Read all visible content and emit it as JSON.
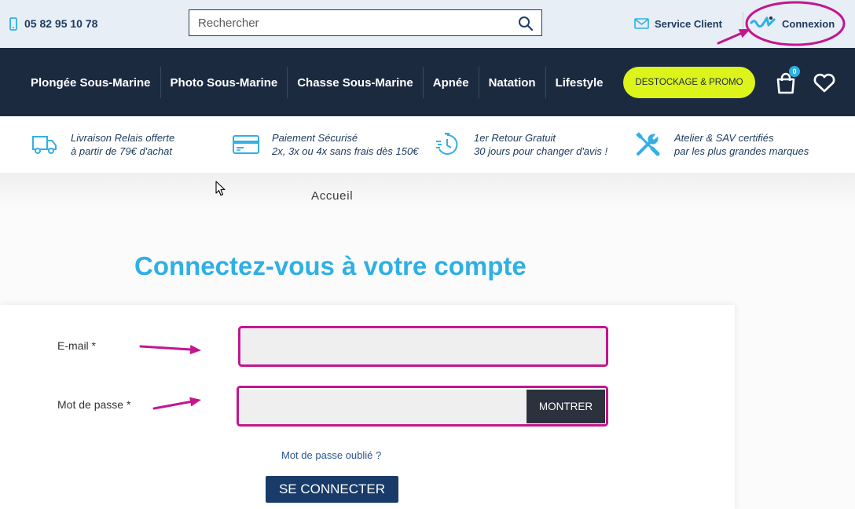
{
  "topbar": {
    "phone": "05 82 95 10 78",
    "phone_icon": "phone-icon",
    "search_placeholder": "Rechercher",
    "search_value": "",
    "service_client": "Service Client",
    "connexion": "Connexion"
  },
  "nav": {
    "items": [
      {
        "label": "Plongée Sous-Marine"
      },
      {
        "label": "Photo Sous-Marine"
      },
      {
        "label": "Chasse Sous-Marine"
      },
      {
        "label": "Apnée"
      },
      {
        "label": "Natation"
      },
      {
        "label": "Lifestyle"
      }
    ],
    "promo": "DESTOCKAGE & PROMO",
    "cart_count": "0"
  },
  "benefits": [
    {
      "icon": "truck-icon",
      "line1": "Livraison Relais offerte",
      "line2": "à partir de 79€ d'achat"
    },
    {
      "icon": "credit-card-icon",
      "line1": "Paiement Sécurisé",
      "line2": "2x, 3x ou 4x sans frais dès 150€"
    },
    {
      "icon": "timer-icon",
      "line1": "1er Retour Gratuit",
      "line2": "30 jours pour changer d'avis !"
    },
    {
      "icon": "tools-icon",
      "line1": "Atelier & SAV certifiés",
      "line2": "par les plus grandes marques"
    }
  ],
  "breadcrumb": {
    "home": "Accueil"
  },
  "page": {
    "title": "Connectez-vous à votre compte"
  },
  "form": {
    "email_label": "E-mail *",
    "email_value": "",
    "password_label": "Mot de passe *",
    "password_value": "",
    "show_button": "MONTRER",
    "forgot_link": "Mot de passe oublié ?",
    "submit": "SE CONNECTER"
  },
  "colors": {
    "accent": "#2eb0e4",
    "topbar_bg": "#e7eef6",
    "nav_bg": "#1c2a40",
    "promo_bg": "#dcf41a",
    "submit_bg": "#183b69",
    "show_button_bg": "#2b313d",
    "link": "#2a5591",
    "annotation": "#c3168e"
  }
}
